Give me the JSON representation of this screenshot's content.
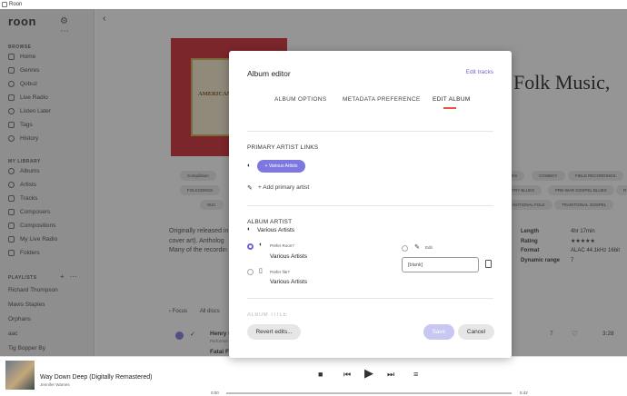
{
  "window": {
    "title": "Roon"
  },
  "sidebar": {
    "logo": "roon",
    "browse_header": "BROWSE",
    "browse": [
      {
        "label": "Home",
        "icon": "home-icon"
      },
      {
        "label": "Genres",
        "icon": "genres-icon"
      },
      {
        "label": "Qobuz",
        "icon": "qobuz-icon"
      },
      {
        "label": "Live Radio",
        "icon": "radio-icon"
      },
      {
        "label": "Listen Later",
        "icon": "clock-icon"
      },
      {
        "label": "Tags",
        "icon": "tag-icon"
      },
      {
        "label": "History",
        "icon": "history-icon"
      }
    ],
    "library_header": "MY LIBRARY",
    "library": [
      {
        "label": "Albums",
        "icon": "album-icon"
      },
      {
        "label": "Artists",
        "icon": "artist-icon"
      },
      {
        "label": "Tracks",
        "icon": "track-icon"
      },
      {
        "label": "Composers",
        "icon": "composer-icon"
      },
      {
        "label": "Compositions",
        "icon": "composition-icon"
      },
      {
        "label": "My Live Radio",
        "icon": "radio-icon"
      },
      {
        "label": "Folders",
        "icon": "folder-icon"
      }
    ],
    "playlists_header": "PLAYLISTS",
    "playlists": [
      "Richard Thompson",
      "Mavis Staples",
      "Orphans",
      "aac",
      "Tig Bopper By"
    ]
  },
  "main": {
    "album_title": "Folk Music,",
    "cover_text": "AMERICAN",
    "tags": [
      "Compilation",
      "UES",
      "COWBOY",
      "FIELD RECORDINGS",
      "FOLKSONGS",
      "NTRY BLUES",
      "PRE-WAR GOSPEL BLUES",
      "R",
      "SUC",
      "RADITIONAL FOLK",
      "TRADITIONAL GOSPEL"
    ],
    "description": [
      "Originally released in",
      "cover art). Antholog",
      "Many of the recordin"
    ],
    "meta": [
      {
        "k": "Length",
        "v": "4hr 17min"
      },
      {
        "k": "Rating",
        "v": "★★★★★"
      },
      {
        "k": "Format",
        "v": "ALAC 44.1kHz 16bit"
      },
      {
        "k": "Dynamic range",
        "v": "7"
      }
    ],
    "focus": "Focus",
    "all_discs": "All discs",
    "tracks": [
      {
        "name": "Henry L",
        "sub": "Performer",
        "count": "7",
        "duration": "3:28"
      },
      {
        "name": "Fatal Flower Garden",
        "sub": "",
        "count": "",
        "duration": ""
      }
    ]
  },
  "modal": {
    "title": "Album editor",
    "edit_tracks": "Edit tracks",
    "tabs": [
      "ALBUM OPTIONS",
      "METADATA PREFERENCE",
      "EDIT ALBUM"
    ],
    "primary_links_header": "PRIMARY ARTIST LINKS",
    "pill": "Various Artists",
    "add_primary": "Add primary artist",
    "album_artist_header": "ALBUM ARTIST",
    "album_artist_value": "Various Artists",
    "prefer_roon_label": "Prefer Roon?",
    "prefer_roon_value": "Various Artists",
    "prefer_file_label": "Prefer file?",
    "prefer_file_value": "Various Artists",
    "edit_label": "Edit",
    "edit_value": "[blank]",
    "revert": "Revert edits...",
    "save": "Save",
    "cancel": "Cancel"
  },
  "player": {
    "title": "Way Down Deep (Digitally Remastered)",
    "artist": "Jennifer Warnes",
    "elapsed": "0:00",
    "total": "5:42"
  }
}
